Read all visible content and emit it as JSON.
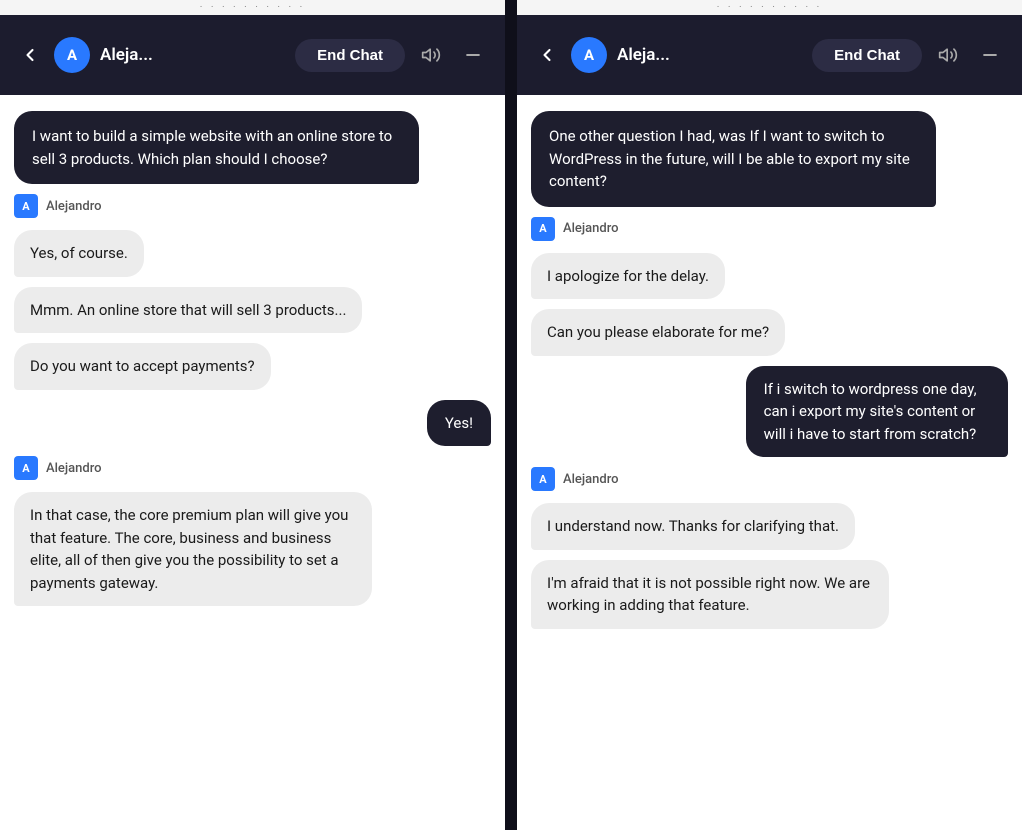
{
  "colors": {
    "dark_bg": "#1c1c2e",
    "bubble_dark": "#1e1e2e",
    "bubble_light": "#ececec",
    "accent_blue": "#2979ff",
    "body_bg": "#ffffff"
  },
  "panel_left": {
    "header": {
      "avatar_letter": "A",
      "agent_name": "Aleja...",
      "end_chat_label": "End Chat"
    },
    "messages": [
      {
        "type": "user_bubble",
        "text": "I want to build a simple website with an online store to sell 3 products. Which plan should I choose?"
      },
      {
        "type": "agent_name",
        "name": "Alejandro"
      },
      {
        "type": "agent_bubble",
        "text": "Yes, of course."
      },
      {
        "type": "agent_bubble",
        "text": "Mmm. An online store that will sell 3 products..."
      },
      {
        "type": "agent_bubble",
        "text": "Do you want to accept payments?"
      },
      {
        "type": "visitor_bubble",
        "text": "Yes!"
      },
      {
        "type": "agent_name",
        "name": "Alejandro"
      },
      {
        "type": "agent_bubble",
        "text": "In that case, the core premium plan will give you that feature. The core, business and business elite, all of then give you the possibility to set a payments gateway."
      }
    ]
  },
  "panel_right": {
    "header": {
      "avatar_letter": "A",
      "agent_name": "Aleja...",
      "end_chat_label": "End Chat"
    },
    "messages": [
      {
        "type": "user_bubble",
        "text": "One other question I had, was If I want to switch to WordPress in the future, will I be able to export my site content?"
      },
      {
        "type": "agent_name",
        "name": "Alejandro"
      },
      {
        "type": "agent_bubble",
        "text": "I apologize for the delay."
      },
      {
        "type": "agent_bubble",
        "text": "Can you please elaborate for me?"
      },
      {
        "type": "visitor_bubble",
        "text": "If i switch to wordpress one day, can i export my site's content or will i have to start from scratch?"
      },
      {
        "type": "agent_name",
        "name": "Alejandro"
      },
      {
        "type": "agent_bubble",
        "text": "I understand now. Thanks for clarifying that."
      },
      {
        "type": "agent_bubble",
        "text": "I'm afraid that it is not possible right now. We are working in adding that feature."
      }
    ]
  }
}
